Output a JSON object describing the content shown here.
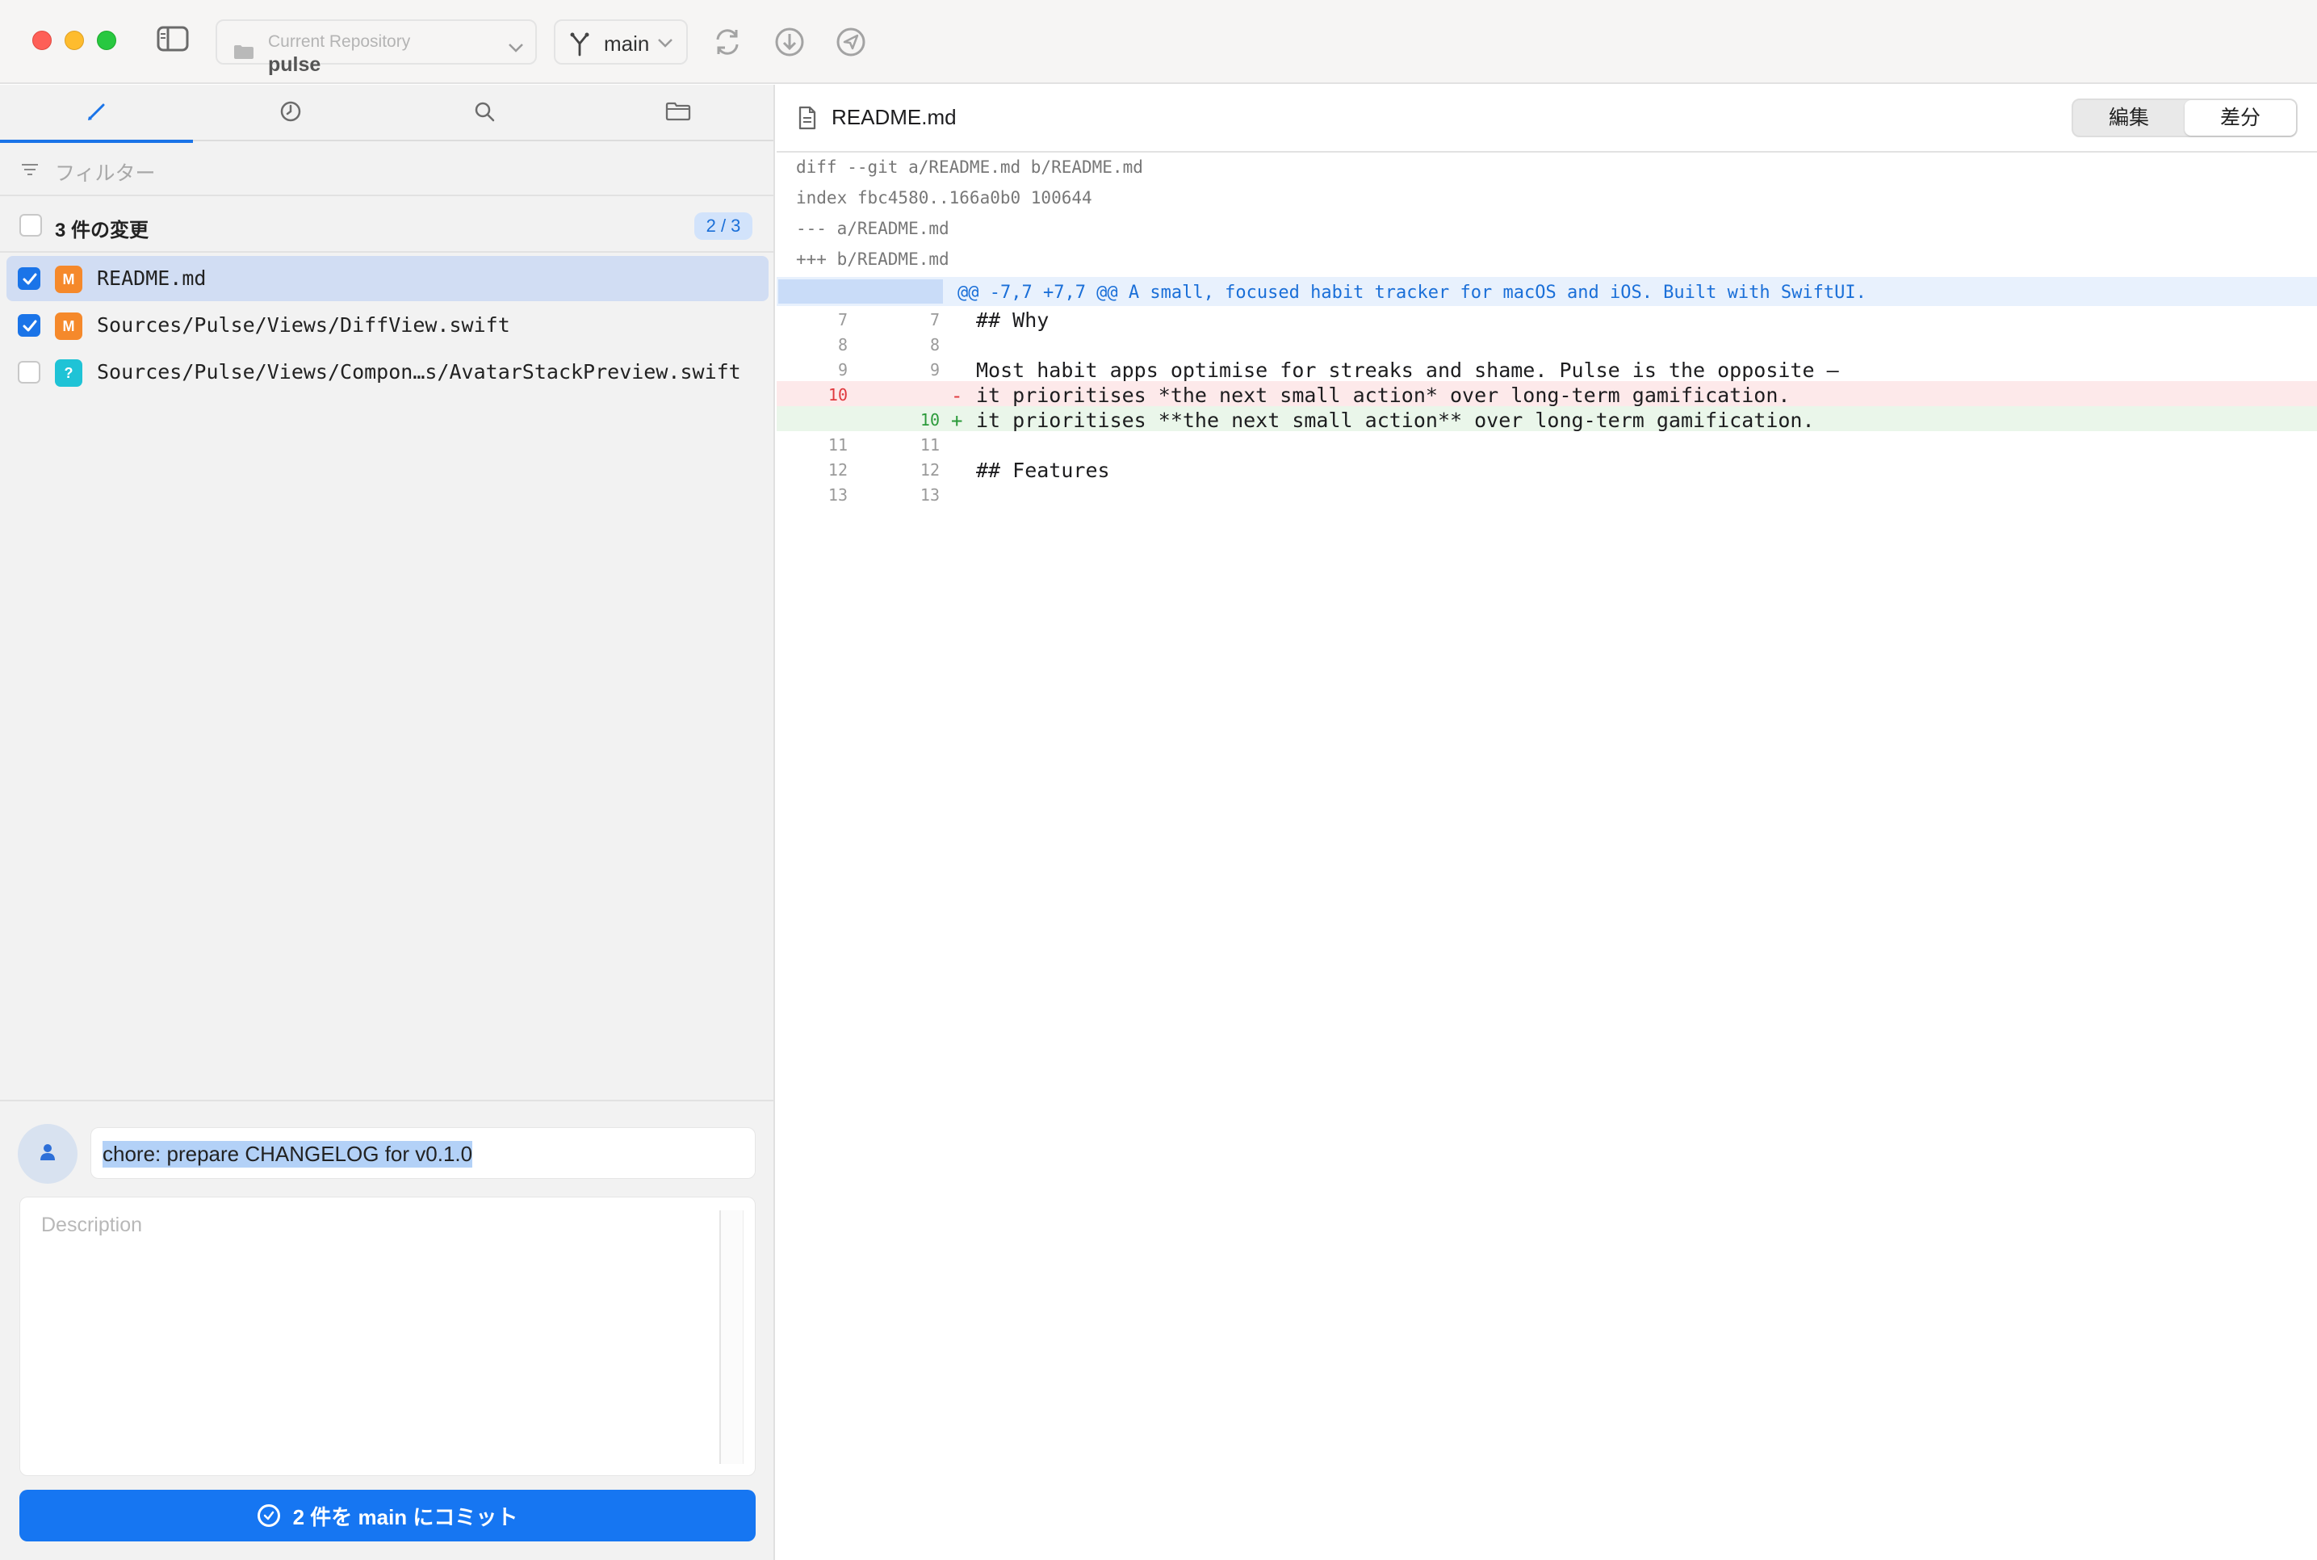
{
  "window": {
    "repo_label": "Current Repository",
    "repo_name": "pulse",
    "branch": "main"
  },
  "sidebar": {
    "tabs": [
      "changes",
      "history",
      "search",
      "files"
    ],
    "filter_placeholder": "フィルター",
    "changes_title": "3 件の変更",
    "changes_count": "2 / 3",
    "files": [
      {
        "status": "M",
        "path": "README.md",
        "checked": true,
        "selected": true
      },
      {
        "status": "M",
        "path": "Sources/Pulse/Views/DiffView.swift",
        "checked": true,
        "selected": false
      },
      {
        "status": "?",
        "path": "Sources/Pulse/Views/Compon…s/AvatarStackPreview.swift",
        "checked": false,
        "selected": false
      }
    ]
  },
  "commit": {
    "summary": "chore: prepare CHANGELOG for v0.1.0",
    "description_placeholder": "Description",
    "button_label": "2 件を main にコミット"
  },
  "diff": {
    "file_name": "README.md",
    "mode_edit": "編集",
    "mode_diff": "差分",
    "meta": [
      "diff --git a/README.md b/README.md",
      "index fbc4580..166a0b0 100644",
      "--- a/README.md",
      "+++ b/README.md"
    ],
    "hunk_header": "@@ -7,7 +7,7 @@ A small, focused habit tracker for macOS and iOS. Built with SwiftUI.",
    "lines": [
      {
        "type": "ctx",
        "old": "7",
        "new": "7",
        "sign": "",
        "text": "## Why"
      },
      {
        "type": "ctx",
        "old": "8",
        "new": "8",
        "sign": "",
        "text": ""
      },
      {
        "type": "ctx",
        "old": "9",
        "new": "9",
        "sign": "",
        "text": "Most habit apps optimise for streaks and shame. Pulse is the opposite —"
      },
      {
        "type": "del",
        "old": "10",
        "new": "",
        "sign": "-",
        "text": "it prioritises *the next small action* over long-term gamification."
      },
      {
        "type": "add",
        "old": "",
        "new": "10",
        "sign": "+",
        "text": "it prioritises **the next small action** over long-term gamification."
      },
      {
        "type": "ctx",
        "old": "11",
        "new": "11",
        "sign": "",
        "text": ""
      },
      {
        "type": "ctx",
        "old": "12",
        "new": "12",
        "sign": "",
        "text": "## Features"
      },
      {
        "type": "ctx",
        "old": "13",
        "new": "13",
        "sign": "",
        "text": ""
      }
    ]
  },
  "colors": {
    "accent": "#1676f2",
    "status_modified": "#f5892b",
    "status_untracked": "#1fc3d6",
    "deletion": "#e0393e",
    "addition": "#2b9a3a"
  }
}
